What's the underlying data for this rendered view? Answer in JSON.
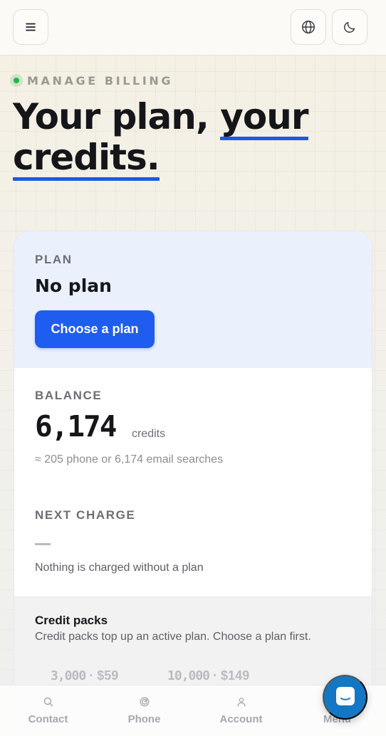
{
  "header": {
    "menu_icon": "hamburger-icon",
    "language_icon": "globe-icon",
    "theme_icon": "moon-icon"
  },
  "hero": {
    "eyebrow": "MANAGE BILLING",
    "title_part1": "Your plan, ",
    "title_highlight1": "your",
    "title_highlight2": "credits.",
    "status_color": "#22b34f",
    "accent_color": "#1f57e6"
  },
  "plan": {
    "label": "PLAN",
    "name": "No plan",
    "choose_label": "Choose a plan"
  },
  "balance": {
    "label": "BALANCE",
    "value": "6,174",
    "unit": "credits",
    "subtext": "≈ 205 phone or 6,174 email searches"
  },
  "next_charge": {
    "label": "NEXT CHARGE",
    "value": "—",
    "note": "Nothing is charged without a plan"
  },
  "packs": {
    "title": "Credit packs",
    "description": "Credit packs top up an active plan. Choose a plan first.",
    "items": [
      {
        "qty": "3,000",
        "price": "· $59"
      },
      {
        "qty": "10,000",
        "price": "· $149"
      }
    ]
  },
  "bottom_nav": {
    "items": [
      {
        "label": "Contact",
        "icon": "search-icon"
      },
      {
        "label": "Phone",
        "icon": "radar-icon"
      },
      {
        "label": "Account",
        "icon": "user-icon"
      },
      {
        "label": "Menu",
        "icon": "menu-icon"
      }
    ]
  },
  "chat": {
    "icon": "chat-icon",
    "color": "#1277c4"
  }
}
